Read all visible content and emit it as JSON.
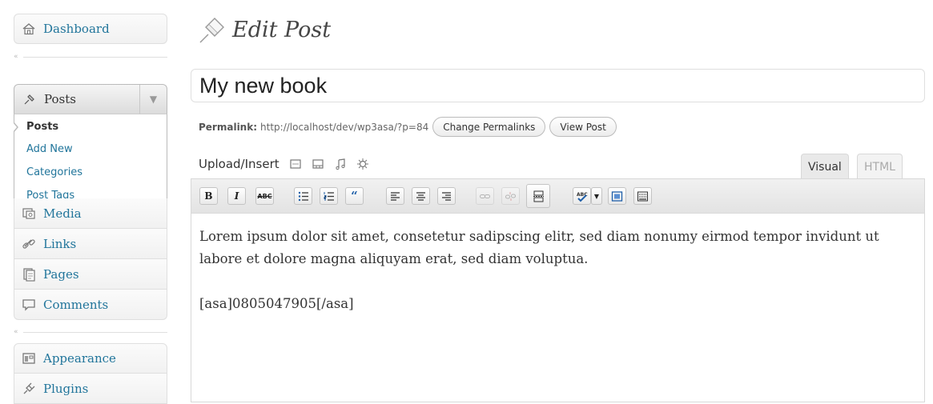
{
  "sidebar": {
    "dashboard": "Dashboard",
    "posts_header": "Posts",
    "posts_submenu": [
      "Posts",
      "Add New",
      "Categories",
      "Post Tags"
    ],
    "media": "Media",
    "links": "Links",
    "pages": "Pages",
    "comments": "Comments",
    "appearance": "Appearance",
    "plugins": "Plugins",
    "collapse_glyph": "«"
  },
  "page": {
    "title": "Edit Post"
  },
  "post": {
    "title_value": "My new book",
    "permalink_label": "Permalink:",
    "permalink_url": "http://localhost/dev/wp3asa/?p=84",
    "change_permalinks": "Change Permalinks",
    "view_post": "View Post"
  },
  "editor": {
    "upload_insert": "Upload/Insert",
    "tab_visual": "Visual",
    "tab_html": "HTML",
    "paragraph1": "Lorem ipsum dolor sit amet, consetetur sadipscing elitr, sed diam nonumy eirmod tempor invidunt ut labore et dolore magna aliquyam erat, sed diam voluptua.",
    "paragraph2": "[asa]0805047905[/asa]",
    "toolbar": {
      "bold": "B",
      "italic": "I",
      "strike": "ABC"
    }
  },
  "colors": {
    "link": "#21759b",
    "border": "#dfdfdf"
  }
}
